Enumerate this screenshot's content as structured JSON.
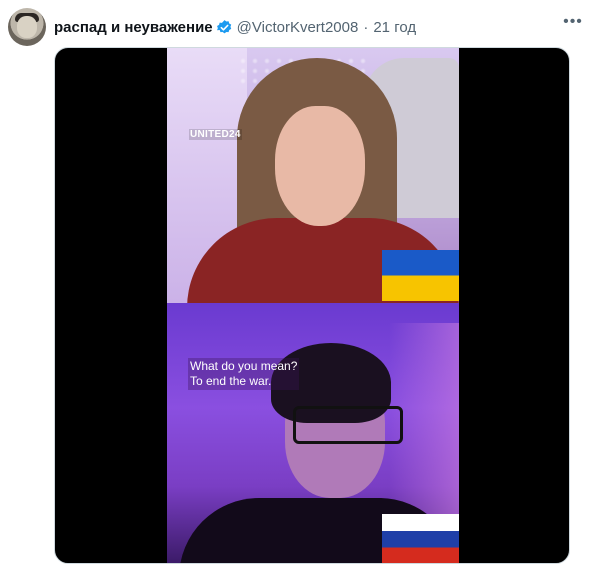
{
  "tweet": {
    "display_name": "распад и неуважение",
    "handle": "@VictorKvert2008",
    "separator": "·",
    "time": "21 год",
    "more_icon": "more-horizontal-icon",
    "verified_color": "#1d9bf0"
  },
  "media": {
    "watermark": "UNITED24",
    "caption_line1": "What do you mean?",
    "caption_line2": "To end the war.",
    "flag_top": "ukraine-flag",
    "flag_bottom": "russia-flag"
  }
}
